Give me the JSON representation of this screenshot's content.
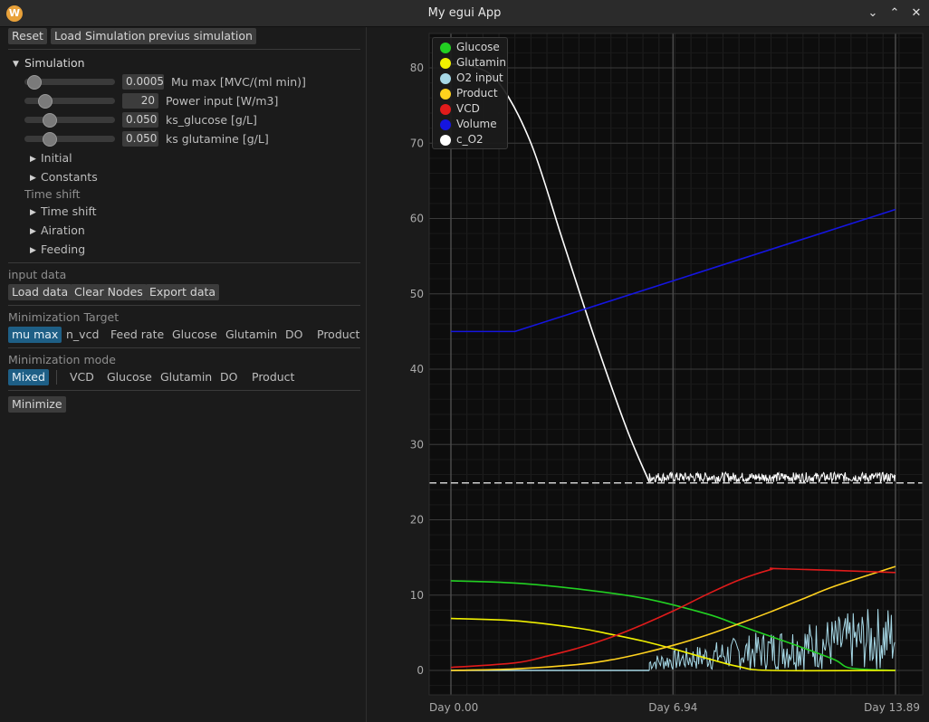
{
  "window": {
    "title": "My egui App",
    "icon_letter": "W"
  },
  "toolbar": {
    "reset": "Reset",
    "load_simulation": "Load Simulation",
    "previous_simulation": "previus simulation"
  },
  "simulation": {
    "header": "Simulation",
    "sliders": [
      {
        "value": "0.0005",
        "label": "Mu max [MVC/(ml min)]",
        "position": 0.12
      },
      {
        "value": "20",
        "label": "Power input [W/m3]",
        "position": 0.24
      },
      {
        "value": "0.050",
        "label": "ks_glucose [g/L]",
        "position": 0.29
      },
      {
        "value": "0.050",
        "label": "ks glutamine [g/L]",
        "position": 0.29
      }
    ],
    "initial": "Initial",
    "constants": "Constants",
    "time_shift_label": "Time shift",
    "time_shift": "Time shift",
    "airation": "Airation",
    "feeding": "Feeding"
  },
  "input_data": {
    "label": "input data",
    "load": "Load data",
    "clear": "Clear Nodes",
    "export": "Export data"
  },
  "min_target": {
    "label": "Minimization Target",
    "options": [
      "mu max",
      "n_vcd",
      "Feed rate",
      "Glucose",
      "Glutamin",
      "DO",
      "Product"
    ],
    "selected": "mu max"
  },
  "min_mode": {
    "label": "Minimization mode",
    "options": [
      "Mixed",
      "VCD",
      "Glucose",
      "Glutamin",
      "DO",
      "Product"
    ],
    "selected": "Mixed"
  },
  "minimize": "Minimize",
  "chart_data": {
    "type": "line",
    "x_range": [
      0,
      13.89
    ],
    "ylim": [
      -4,
      84
    ],
    "y_ticks": [
      0,
      10,
      20,
      30,
      40,
      50,
      60,
      70,
      80
    ],
    "x_tick_labels": [
      "Day 0.00",
      "Day 6.94",
      "Day 13.89"
    ],
    "x_tick_values": [
      0,
      6.94,
      13.89
    ],
    "reference_line": 24.9,
    "legend": [
      {
        "name": "Glucose",
        "color": "#22d022"
      },
      {
        "name": "Glutamin",
        "color": "#f0f000"
      },
      {
        "name": "O2 input",
        "color": "#a6d8e6"
      },
      {
        "name": "Product",
        "color": "#ffd21e"
      },
      {
        "name": "VCD",
        "color": "#e01b1b"
      },
      {
        "name": "Volume",
        "color": "#1515e0"
      },
      {
        "name": "c_O2",
        "color": "#ffffff"
      }
    ],
    "series": [
      {
        "name": "c_O2",
        "color": "#ffffff",
        "x": [
          0,
          0.7,
          1.5,
          2.5,
          3.5,
          4.5,
          5.5,
          6.2
        ],
        "y": [
          80.5,
          80.2,
          78,
          70,
          57,
          44,
          32,
          25
        ]
      },
      {
        "name": "Volume",
        "color": "#1515e0",
        "x": [
          0,
          2.0,
          13.89
        ],
        "y": [
          45,
          45,
          61.2
        ]
      },
      {
        "name": "Glucose",
        "color": "#22d022",
        "x": [
          0,
          2,
          4,
          6,
          8,
          9,
          10,
          11,
          12,
          12.5,
          13.89
        ],
        "y": [
          11.9,
          11.6,
          10.8,
          9.6,
          7.5,
          6.0,
          4.5,
          3.0,
          1.4,
          0.3,
          0
        ]
      },
      {
        "name": "Glutamin",
        "color": "#f0f000",
        "x": [
          0,
          2,
          4,
          5,
          6,
          7,
          8,
          9,
          10,
          13.89
        ],
        "y": [
          6.9,
          6.6,
          5.6,
          4.8,
          3.9,
          2.8,
          1.6,
          0.5,
          0,
          0
        ]
      },
      {
        "name": "Product",
        "color": "#ffd21e",
        "x": [
          0,
          2,
          4,
          5,
          6,
          7,
          8,
          9,
          10,
          11,
          12,
          13.89
        ],
        "y": [
          0,
          0.2,
          0.8,
          1.4,
          2.3,
          3.4,
          4.7,
          6.2,
          7.8,
          9.5,
          11.2,
          13.8
        ]
      },
      {
        "name": "VCD",
        "color": "#e01b1b",
        "x": [
          0,
          2,
          3,
          4,
          5,
          6,
          7,
          8,
          9,
          10,
          10.3,
          13.89
        ],
        "y": [
          0.4,
          1.0,
          1.9,
          3.0,
          4.4,
          6.1,
          8.0,
          10.1,
          12.0,
          13.4,
          13.5,
          13.0
        ]
      },
      {
        "name": "O2 input",
        "color": "#a6d8e6",
        "x": [
          0,
          6.2
        ],
        "y": [
          0,
          0
        ]
      }
    ]
  }
}
